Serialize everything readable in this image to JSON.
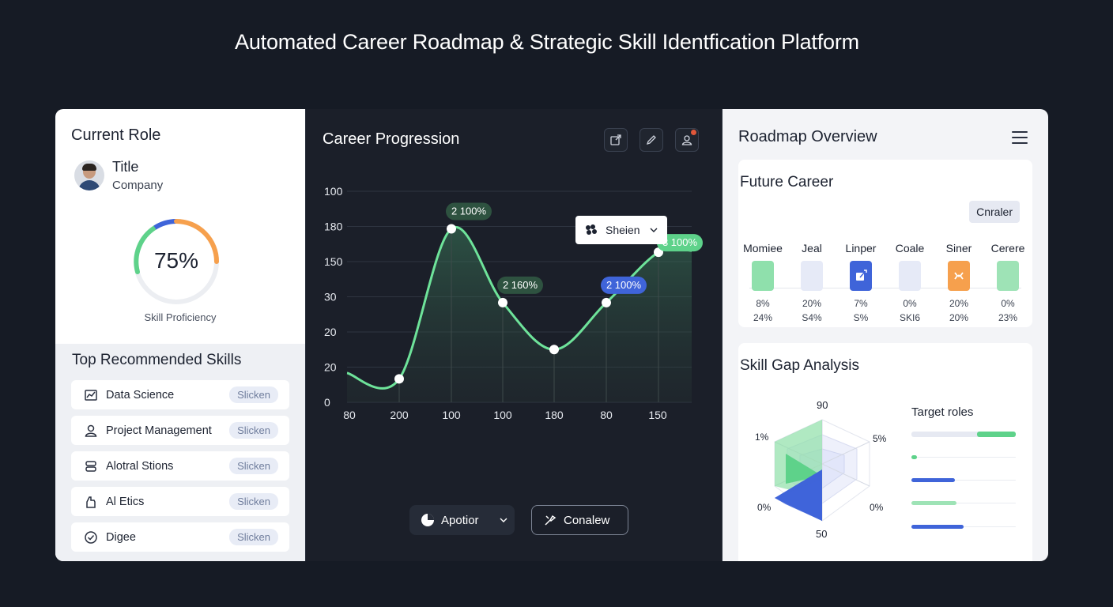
{
  "page": {
    "title": "Automated Career Roadmap & Strategic Skill Identfication Platform"
  },
  "colors": {
    "accent_green": "#5ed28a",
    "accent_blue": "#3f64d9",
    "accent_orange": "#f6a04d"
  },
  "left": {
    "current_role_heading": "Current Role",
    "profile": {
      "title": "Title",
      "company": "Company",
      "avatar_icon": "user-avatar"
    },
    "gauge": {
      "value": "75%",
      "label": "Skill Proficiency",
      "fraction": 0.75
    },
    "skills_heading": "Top Recommended Skills",
    "skills": [
      {
        "name": "Data Science",
        "badge": "Slicken",
        "icon": "chart-icon"
      },
      {
        "name": "Project Management",
        "badge": "Slicken",
        "icon": "user-icon"
      },
      {
        "name": "Alotral Stions",
        "badge": "Slicken",
        "icon": "stack-icon"
      },
      {
        "name": "Al Etics",
        "badge": "Slicken",
        "icon": "hand-icon"
      },
      {
        "name": "Digee",
        "badge": "Slicken",
        "icon": "check-circle-icon"
      }
    ]
  },
  "center": {
    "heading": "Career Progression",
    "filter": {
      "label": "Sheien",
      "icon": "group-icon"
    },
    "buttons": {
      "primary": "Apotior",
      "secondary": "Conalew"
    }
  },
  "chart_data": {
    "type": "line",
    "title": "Career Progression",
    "y_ticks": [
      "100",
      "180",
      "150",
      "30",
      "20",
      "20",
      "0"
    ],
    "x_ticks": [
      "80",
      "200",
      "100",
      "100",
      "180",
      "80",
      "150"
    ],
    "series": [
      {
        "values": [
          20,
          148,
          85,
          45,
          85,
          128
        ],
        "point_labels": [
          "",
          "2 100%",
          "2 160%",
          "",
          "2 100%",
          "3 100%"
        ]
      }
    ],
    "grid": true
  },
  "right": {
    "heading": "Roadmap Overview",
    "future_career": {
      "heading": "Future Career",
      "chip": "Cnraler",
      "columns": [
        {
          "name": "Momiee",
          "v1": "8%",
          "v2": "24%",
          "color": "#8fe0ac",
          "icon": ""
        },
        {
          "name": "Jeal",
          "v1": "20%",
          "v2": "S4%",
          "color": "#e6eaf7",
          "icon": ""
        },
        {
          "name": "Linper",
          "v1": "7%",
          "v2": "S%",
          "color": "#3f64d9",
          "icon": "edit-icon"
        },
        {
          "name": "Coale",
          "v1": "0%",
          "v2": "SKI6",
          "color": "#e6eaf7",
          "icon": ""
        },
        {
          "name": "Siner",
          "v1": "20%",
          "v2": "20%",
          "color": "#f6a04d",
          "icon": "signal-icon"
        },
        {
          "name": "Cerere",
          "v1": "0%",
          "v2": "23%",
          "color": "#9ee3b6",
          "icon": ""
        }
      ]
    },
    "skill_gap": {
      "heading": "Skill Gap Analysis",
      "radar_labels": {
        "top": "90",
        "left": "1%",
        "right": "5%",
        "bottom_left": "0%",
        "bottom_right": "0%",
        "bottom": "50"
      },
      "target_roles_label": "Target roles",
      "target_bars": [
        {
          "fill": 0.37,
          "color": "#5ed28a"
        },
        {
          "fill": 0.05,
          "color": "#5ed28a"
        },
        {
          "fill": 0.42,
          "color": "#3f64d9"
        },
        {
          "fill": 0.43,
          "color": "#9ee3b6"
        },
        {
          "fill": 0.5,
          "color": "#3f64d9"
        }
      ]
    }
  }
}
